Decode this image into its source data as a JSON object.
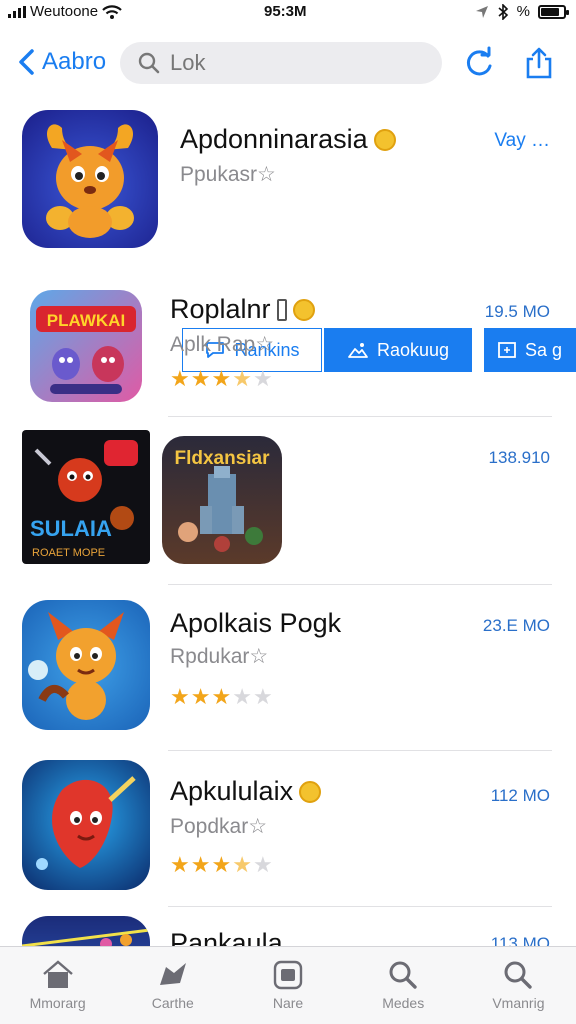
{
  "status": {
    "carrier": "Weutoone",
    "time": "95:3M",
    "battery_text": "%",
    "battery_level": 0.8
  },
  "nav": {
    "back_label": "Aabro",
    "search_value": "Lok"
  },
  "featured": {
    "title": "Apdonninarasia",
    "subtitle": "Ppukasr☆",
    "action": "Vay …",
    "buttons": [
      "Rankins",
      "Raokuug",
      "Sa g"
    ]
  },
  "apps": [
    {
      "title": "Roplalnr",
      "subtitle": "Aplk Rap☆",
      "size": "19.5 MO",
      "rating": 3.5,
      "icon_text": "PLAWKAI"
    },
    {
      "title": "",
      "subtitle": "",
      "size": "138.910",
      "rating": 0,
      "icon_text_a": "SULAIA",
      "icon_text_a2": "ROAET MOPE",
      "icon_text_b": "Fldxansiar"
    },
    {
      "title": "Apolkais Pogk",
      "subtitle": "Rpdukar☆",
      "size": "23.E MO",
      "rating": 3
    },
    {
      "title": "Apkululaix",
      "subtitle": "Popdkar☆",
      "size": "112 MO",
      "rating": 3.5
    },
    {
      "title": "Pankaula",
      "subtitle": "",
      "size": "113 MO",
      "rating": 0
    }
  ],
  "tabs": [
    {
      "label": "Mmorarg",
      "icon": "home-icon"
    },
    {
      "label": "Carthe",
      "icon": "games-icon"
    },
    {
      "label": "Nare",
      "icon": "apps-icon"
    },
    {
      "label": "Medes",
      "icon": "search-icon"
    },
    {
      "label": "Vmanrig",
      "icon": "search-icon"
    }
  ],
  "colors": {
    "accent": "#1a7df0",
    "star": "#f2a51a",
    "size_text": "#2a6fc9"
  }
}
